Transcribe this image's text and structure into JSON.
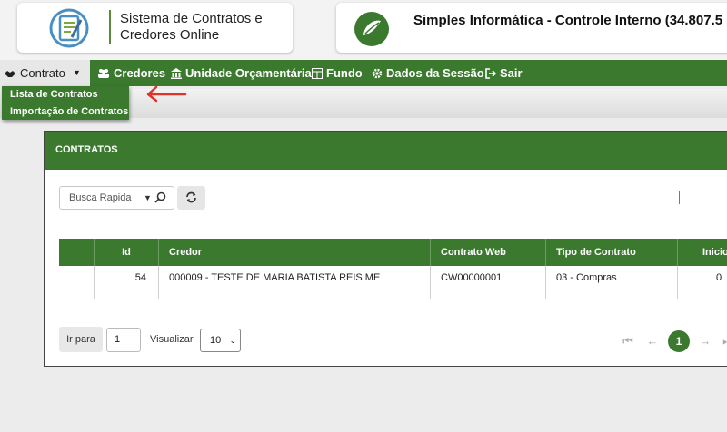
{
  "header": {
    "system_title_line1": "Sistema de Contratos e",
    "system_title_line2": "Credores Online",
    "brand_title": "Simples Informática - Controle Interno   (34.807.5"
  },
  "nav": {
    "contrato": "Contrato",
    "credores": "Credores",
    "unidade": "Unidade Orçamentária",
    "fundo": "Fundo",
    "dados_sessao": "Dados da Sessão",
    "sair": "Sair"
  },
  "dropdown": {
    "items": [
      "Lista de Contratos",
      "Importação de Contratos"
    ]
  },
  "panel": {
    "title": "CONTRATOS",
    "search_placeholder": "Busca Rapida"
  },
  "table": {
    "headers": [
      "Id",
      "Credor",
      "Contrato Web",
      "Tipo de Contrato",
      "Inicio"
    ],
    "rows": [
      {
        "id": "54",
        "credor": "000009 - TESTE DE MARIA BATISTA REIS ME",
        "contrato_web": "CW00000001",
        "tipo": "03 - Compras",
        "inicio": "0"
      }
    ]
  },
  "pagination": {
    "go_label": "Ir para",
    "page_value": "1",
    "view_label": "Visualizar",
    "page_size": "10",
    "current_page": "1"
  },
  "colors": {
    "primary_green": "#3b7a2e"
  }
}
